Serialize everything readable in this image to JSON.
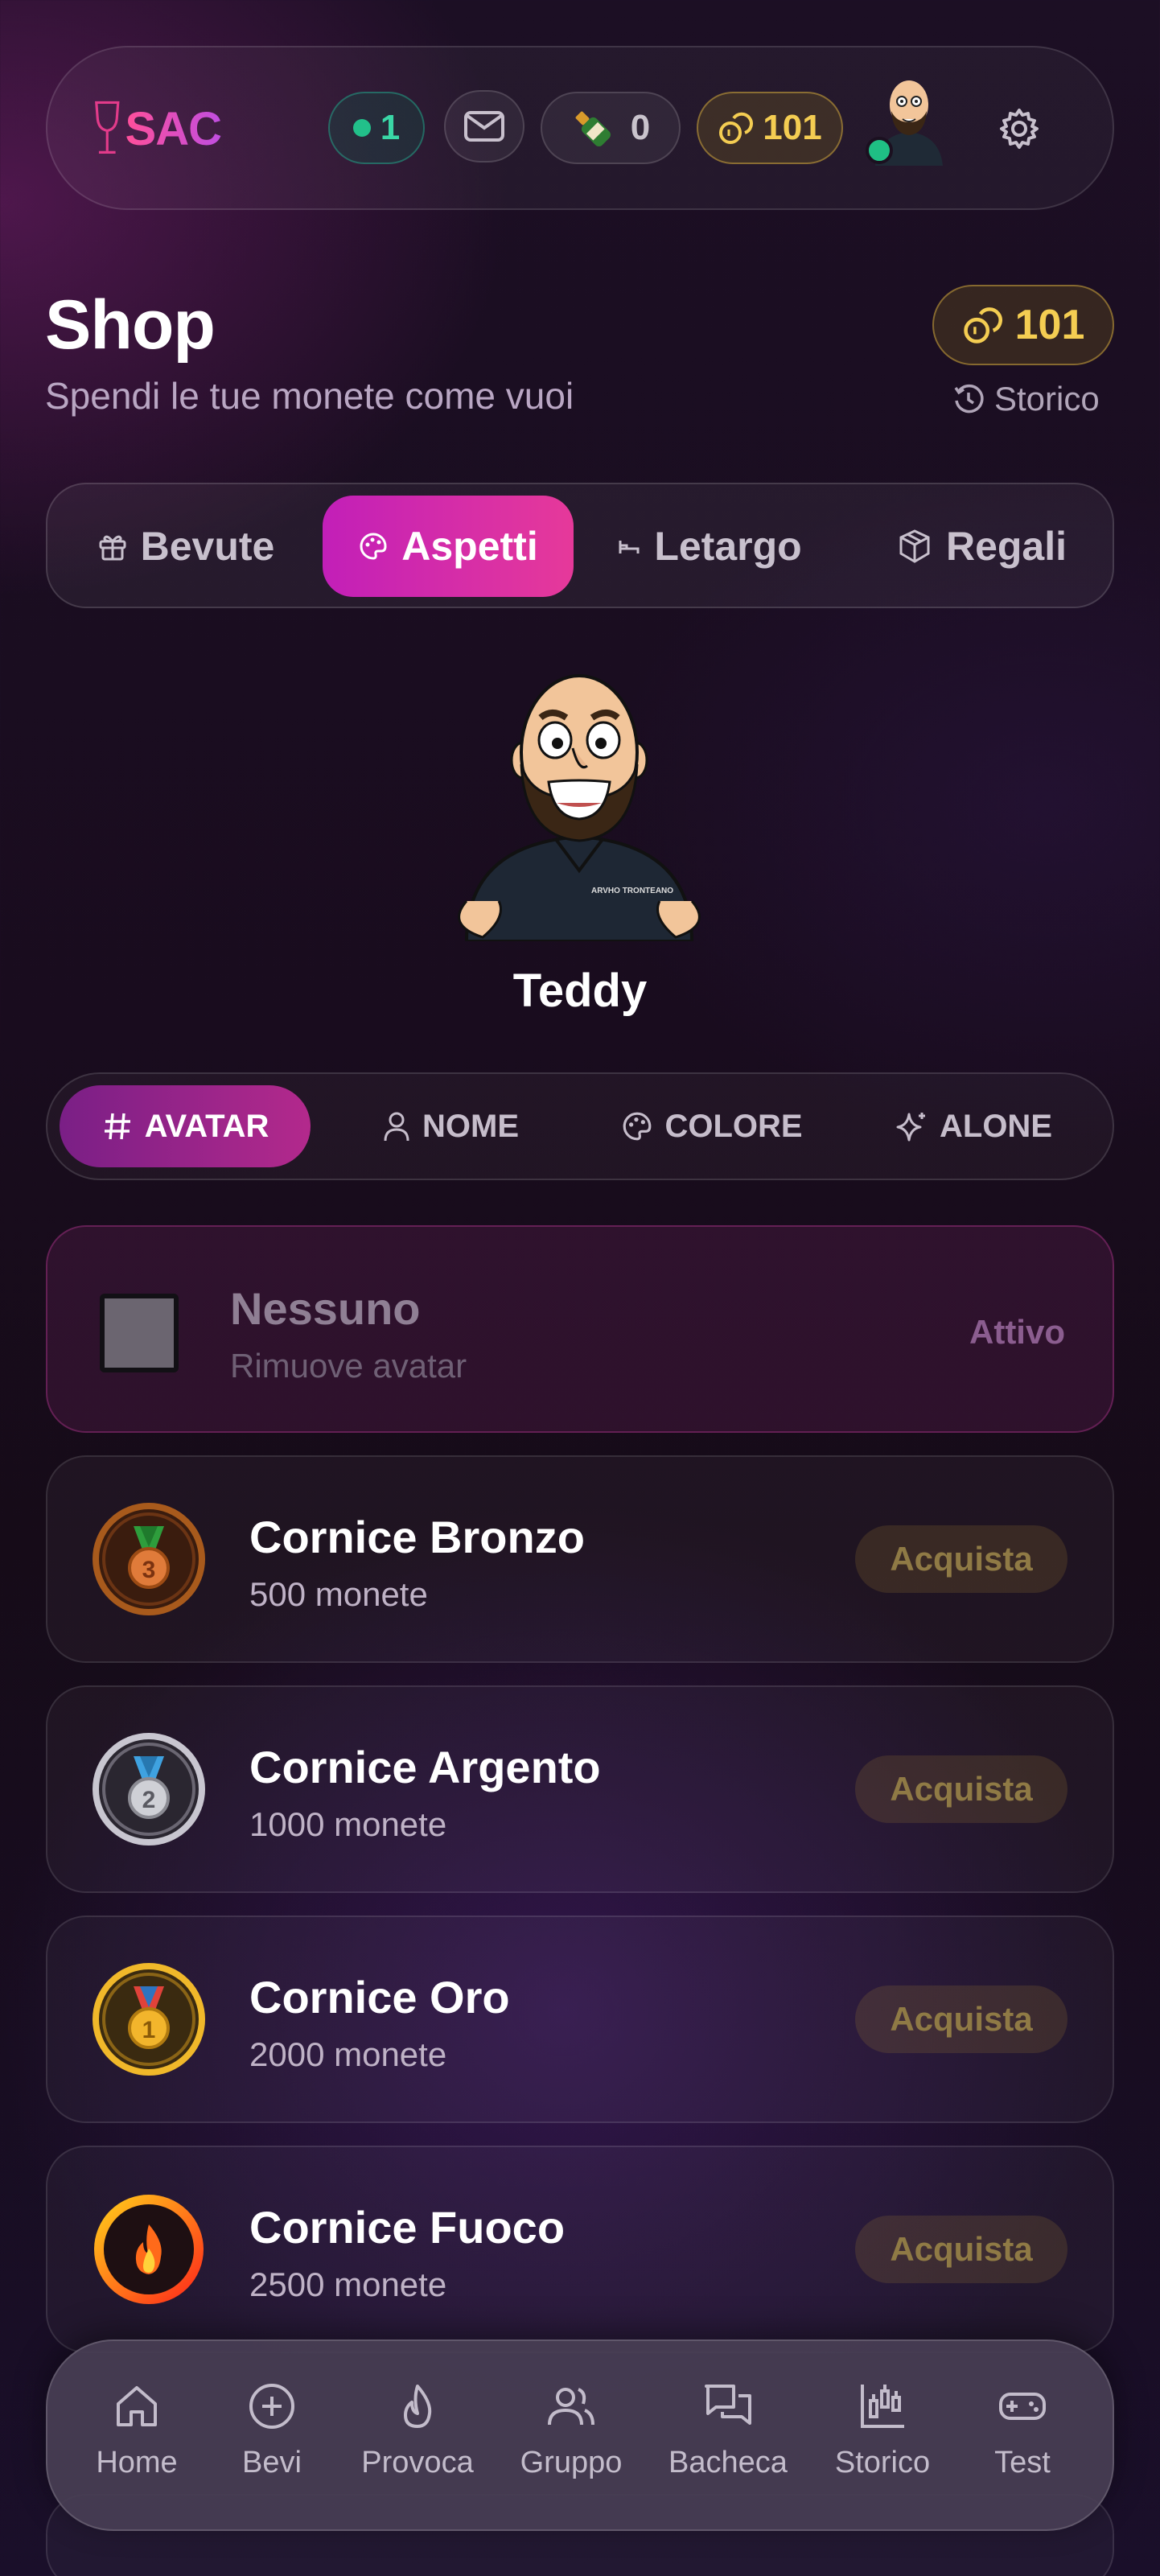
{
  "header": {
    "logo_text": "SAC",
    "online_count": "1",
    "drinks_count": "0",
    "coins": "101"
  },
  "page": {
    "title": "Shop",
    "subtitle": "Spendi le tue monete come vuoi",
    "balance": "101",
    "history_label": "Storico"
  },
  "tabs": [
    {
      "label": "Bevute",
      "icon": "gift-icon",
      "active": false
    },
    {
      "label": "Aspetti",
      "icon": "palette-icon",
      "active": true
    },
    {
      "label": "Letargo",
      "icon": "bed-icon",
      "active": false
    },
    {
      "label": "Regali",
      "icon": "box-icon",
      "active": false
    }
  ],
  "character": {
    "name": "Teddy",
    "shirt_text": "ARVHO TRONTEANO"
  },
  "subtabs": [
    {
      "label": "AVATAR",
      "icon": "hash-icon",
      "active": true
    },
    {
      "label": "NOME",
      "icon": "user-icon",
      "active": false
    },
    {
      "label": "COLORE",
      "icon": "palette-icon",
      "active": false
    },
    {
      "label": "ALONE",
      "icon": "sparkles-icon",
      "active": false
    }
  ],
  "items": [
    {
      "name": "Nessuno",
      "price": "Rimuove avatar",
      "action": "Attivo",
      "icon": "empty-square-icon"
    },
    {
      "name": "Cornice Bronzo",
      "price": "500 monete",
      "action": "Acquista",
      "icon": "bronze-medal-icon",
      "medal_number": "3",
      "color": "#b5651d"
    },
    {
      "name": "Cornice Argento",
      "price": "1000 monete",
      "action": "Acquista",
      "icon": "silver-medal-icon",
      "medal_number": "2",
      "color": "#c0c0c8"
    },
    {
      "name": "Cornice Oro",
      "price": "2000 monete",
      "action": "Acquista",
      "icon": "gold-medal-icon",
      "medal_number": "1",
      "color": "#f0b82a"
    },
    {
      "name": "Cornice Fuoco",
      "price": "2500 monete",
      "action": "Acquista",
      "icon": "fire-icon",
      "color": "#ff4b1f"
    }
  ],
  "nav": [
    {
      "label": "Home",
      "icon": "home-icon"
    },
    {
      "label": "Bevi",
      "icon": "plus-circle-icon"
    },
    {
      "label": "Provoca",
      "icon": "flame-icon"
    },
    {
      "label": "Gruppo",
      "icon": "users-icon"
    },
    {
      "label": "Bacheca",
      "icon": "chat-icon"
    },
    {
      "label": "Storico",
      "icon": "chart-icon"
    },
    {
      "label": "Test",
      "icon": "gamepad-icon"
    }
  ],
  "colors": {
    "accent_pink": "#e6399a",
    "coin_gold": "#f4cd52",
    "online_green": "#22c08a"
  }
}
